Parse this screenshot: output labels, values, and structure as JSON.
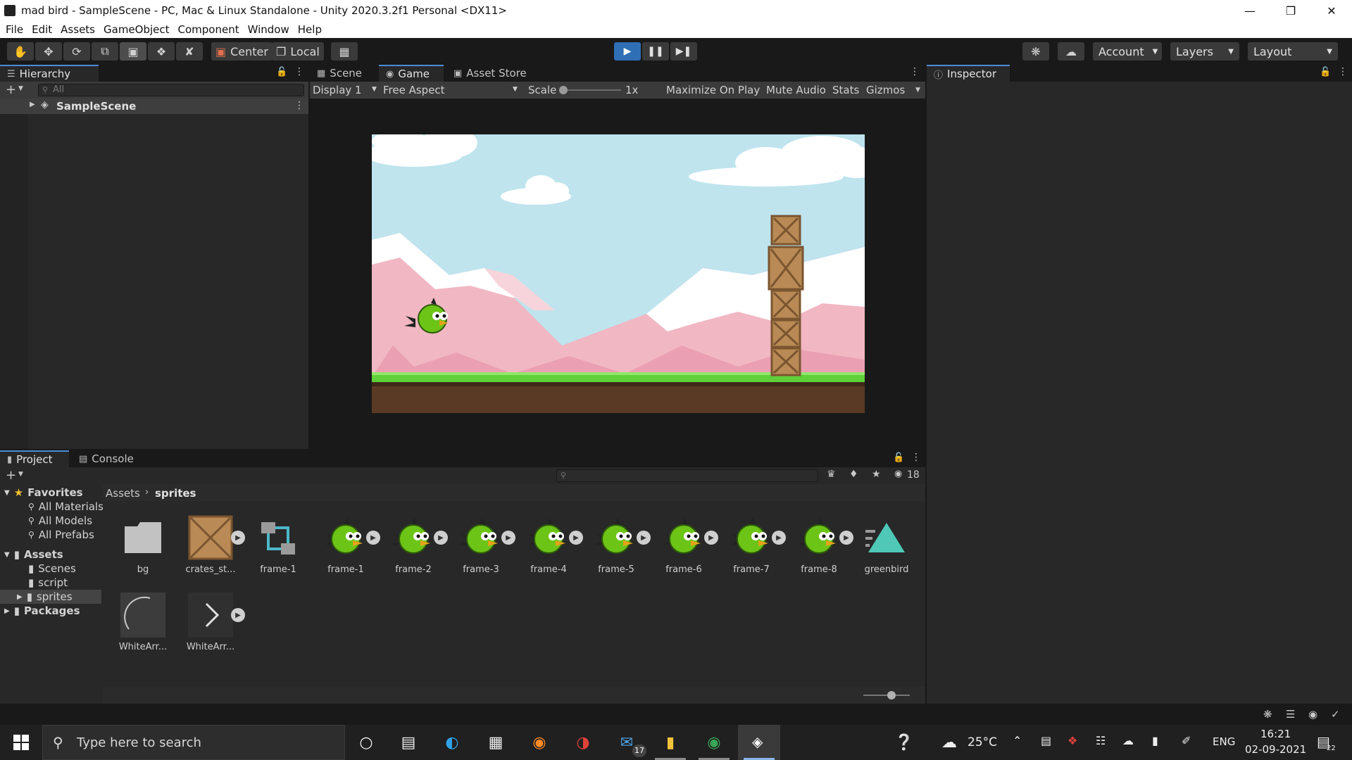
{
  "window": {
    "title": "mad bird - SampleScene - PC, Mac & Linux Standalone - Unity 2020.3.2f1 Personal <DX11>"
  },
  "menu": [
    "File",
    "Edit",
    "Assets",
    "GameObject",
    "Component",
    "Window",
    "Help"
  ],
  "toolbar": {
    "pivot_label": "Center",
    "space_label": "Local",
    "account_label": "Account",
    "layers_label": "Layers",
    "layout_label": "Layout"
  },
  "hierarchy": {
    "tab_label": "Hierarchy",
    "search_placeholder": "All",
    "scene_name": "SampleScene"
  },
  "center_tabs": [
    {
      "label": "Scene",
      "icon": "grid-icon"
    },
    {
      "label": "Game",
      "icon": "gamepad-icon"
    },
    {
      "label": "Asset Store",
      "icon": "bag-icon"
    }
  ],
  "gamebar": {
    "display": "Display 1",
    "aspect": "Free Aspect",
    "scale_label": "Scale",
    "scale_value": "1x",
    "scale_fraction": 0.0,
    "maximize": "Maximize On Play",
    "mute": "Mute Audio",
    "stats": "Stats",
    "gizmos": "Gizmos"
  },
  "inspector": {
    "tab_label": "Inspector"
  },
  "project": {
    "tabs": [
      "Project",
      "Console"
    ],
    "hidden_count": "18",
    "breadcrumb": [
      "Assets",
      "sprites"
    ],
    "tree": {
      "favorites": "Favorites",
      "fav_items": [
        "All Materials",
        "All Models",
        "All Prefabs"
      ],
      "assets": "Assets",
      "asset_folders": [
        "Scenes",
        "script",
        "sprites"
      ],
      "packages": "Packages"
    },
    "assets": [
      "bg",
      "crates_st...",
      "frame-1",
      "frame-1",
      "frame-2",
      "frame-3",
      "frame-4",
      "frame-5",
      "frame-6",
      "frame-7",
      "frame-8",
      "greenbird",
      "WhiteArr...",
      "WhiteArr..."
    ]
  },
  "taskbar": {
    "search_placeholder": "Type here to search",
    "mail_badge": "17",
    "weather": "25°C",
    "lang": "ENG",
    "time": "16:21",
    "date": "02-09-2021",
    "notif_count": "22"
  },
  "colors": {
    "accent": "#2f6fb5",
    "tab_highlight": "#4d8ad6",
    "sky": "#bfe4ee",
    "mountain": "#f1b7c3",
    "snow": "#ffffff",
    "grass": "#5fd03a",
    "dirt": "#5a3a24",
    "bird": "#6cc417"
  }
}
